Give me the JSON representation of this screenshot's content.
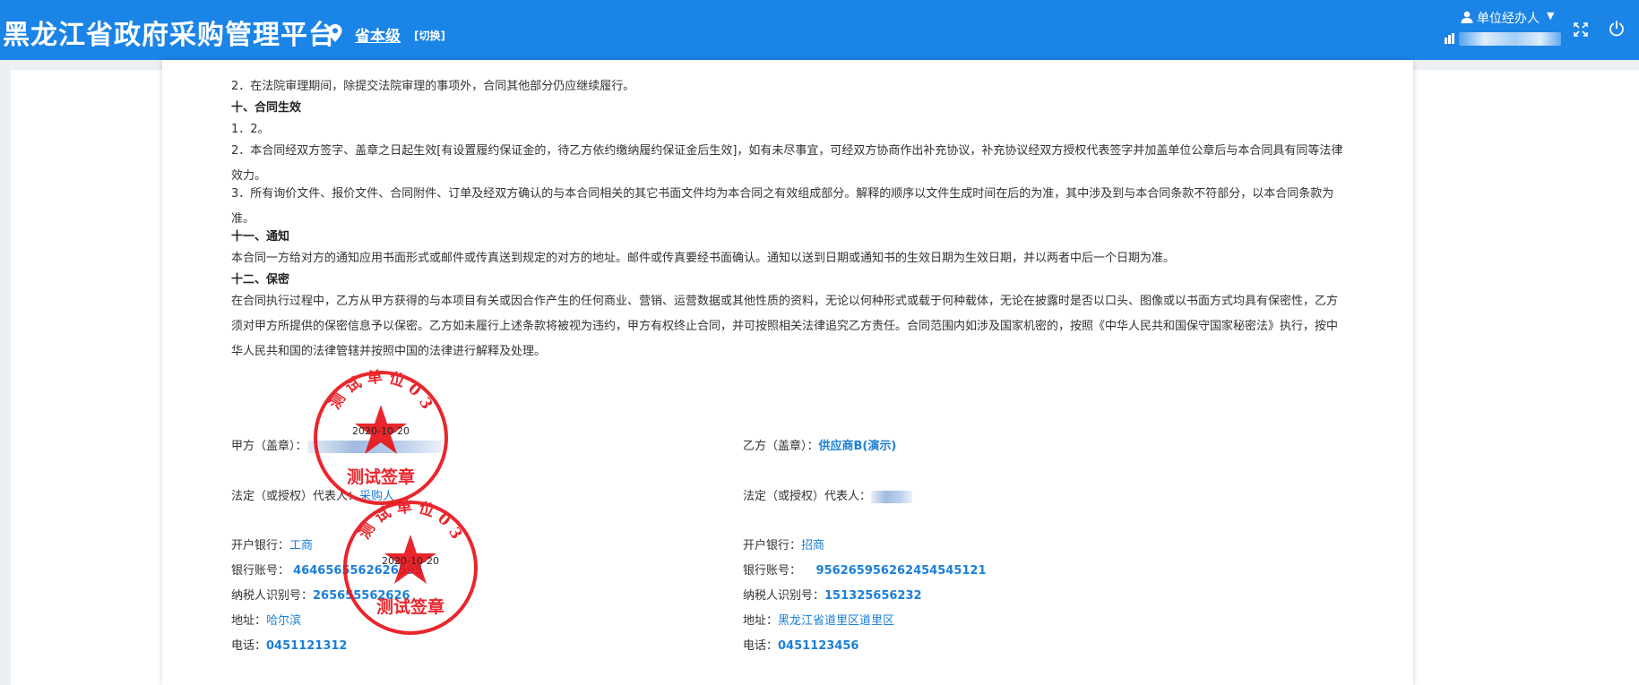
{
  "header": {
    "app_title": "黑龙江省政府采购管理平台",
    "region": "省本级",
    "switch_label": "[切换]",
    "user_role": "单位经办人",
    "user_caret": "▼"
  },
  "document": {
    "paragraphs": [
      {
        "id": "p1",
        "text": "2．在法院审理期间，除提交法院审理的事项外，合同其他部分仍应继续履行。"
      },
      {
        "id": "h10",
        "text": "十、合同生效",
        "heading": true
      },
      {
        "id": "p2",
        "text": "1．2。"
      },
      {
        "id": "p3",
        "text": "2．本合同经双方签字、盖章之日起生效[有设置履约保证金的，待乙方依约缴纳履约保证金后生效]，如有未尽事宜，可经双方协商作出补充协议，补充协议经双方授权代表签字并加盖单位公章后与本合同具有同等法律效力。"
      },
      {
        "id": "p4",
        "text": "3．所有询价文件、报价文件、合同附件、订单及经双方确认的与本合同相关的其它书面文件均为本合同之有效组成部分。解释的顺序以文件生成时间在后的为准，其中涉及到与本合同条款不符部分，以本合同条款为准。"
      },
      {
        "id": "h11",
        "text": "十一、通知",
        "heading": true
      },
      {
        "id": "p5",
        "text": "本合同一方给对方的通知应用书面形式或邮件或传真送到规定的对方的地址。邮件或传真要经书面确认。通知以送到日期或通知书的生效日期为生效日期，并以两者中后一个日期为准。"
      },
      {
        "id": "h12",
        "text": "十二、保密",
        "heading": true
      },
      {
        "id": "p6",
        "text": "在合同执行过程中，乙方从甲方获得的与本项目有关或因合作产生的任何商业、营销、运营数据或其他性质的资料，无论以何种形式或载于何种载体，无论在披露时是否以口头、图像或以书面方式均具有保密性，乙方须对甲方所提供的保密信息予以保密。乙方如未履行上述条款将被视为违约，甲方有权终止合同，并可按照相关法律追究乙方责任。合同范围内如涉及国家机密的，按照《中华人民共和国保守国家秘密法》执行，按中华人民共和国的法律管辖并按照中国的法律进行解释及处理。"
      }
    ],
    "party_a": {
      "seal_label": "甲方（盖章）：",
      "rep_label": "法定（或授权）代表人：",
      "rep_value": "采购人",
      "bank_label": "开户银行：",
      "bank_value": "工商",
      "account_label": "银行账号：",
      "account_value": "4646565562626595",
      "tax_label": "纳税人识别号：",
      "tax_value": "265655562626",
      "addr_label": "地址：",
      "addr_value": "哈尔滨",
      "phone_label": "电话：",
      "phone_value": "0451121312"
    },
    "party_b": {
      "seal_label": "乙方（盖章）：",
      "seal_value": "供应商B(演示)",
      "rep_label": "法定（或授权）代表人：",
      "bank_label": "开户银行：",
      "bank_value": "招商",
      "account_label": "银行账号：",
      "account_value": "956265956262454545121",
      "tax_label": "纳税人识别号：",
      "tax_value": "151325656232",
      "addr_label": "地址：",
      "addr_value": "黑龙江省道里区道里区",
      "phone_label": "电话：",
      "phone_value": "0451123456"
    },
    "stamps": [
      {
        "arc_text": "测 试 单 位 0 3",
        "date": "2020-10-20",
        "bottom_text": "测试签章"
      },
      {
        "arc_text": "测 试 单 位 0 3",
        "date": "2020-10-20",
        "bottom_text": "测试签章"
      }
    ]
  },
  "colors": {
    "header_bg": "#1b84e7",
    "link_blue": "#1a7fd8",
    "stamp_red": "#e8141b",
    "page_bg": "#eceff3"
  },
  "icons": [
    "location-pin-icon",
    "user-icon",
    "org-icon",
    "fullscreen-icon",
    "power-icon",
    "star-icon"
  ]
}
